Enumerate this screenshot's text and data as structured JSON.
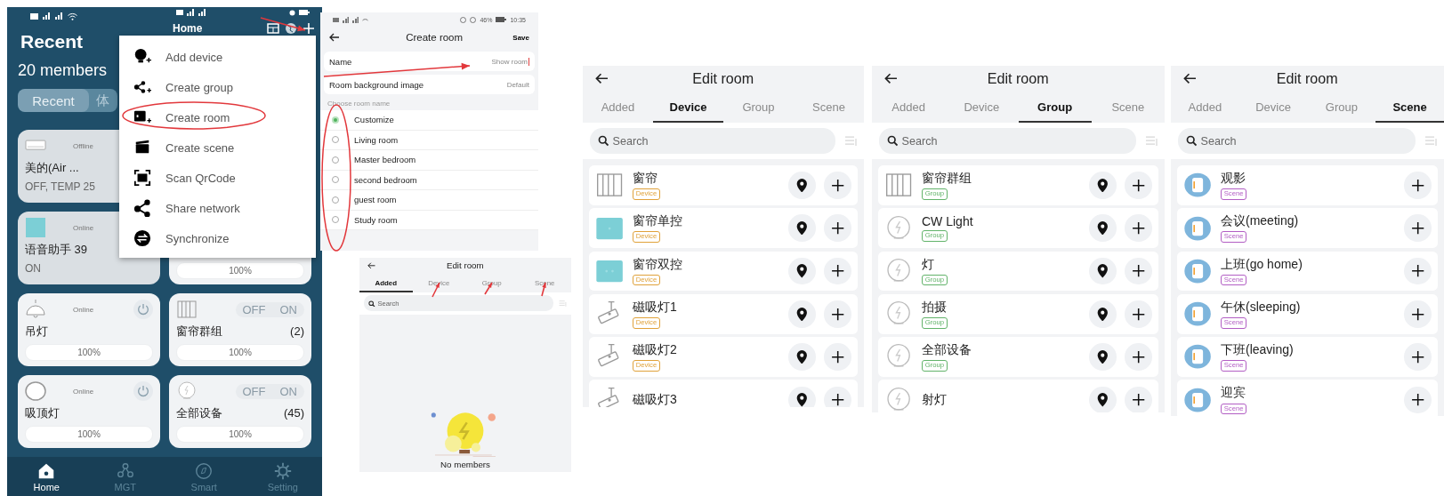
{
  "home_screen": {
    "title": "Recent",
    "members": "20 members",
    "tabs": [
      {
        "label": "Recent",
        "selected": true
      },
      {
        "label": "体",
        "selected": false
      }
    ],
    "cards": [
      {
        "kind": "summary",
        "icon": {
          "kind": "ac"
        },
        "status": "Offline",
        "name": "美的(Air ...",
        "detail": "OFF, TEMP 25"
      },
      {
        "kind": "summary",
        "icon": {
          "kind": "speaker"
        },
        "status": "Online",
        "name": "语音助手 39",
        "detail": "ON"
      },
      {
        "kind": "partial",
        "reading": "100%"
      },
      {
        "kind": "switch",
        "icon": {
          "kind": "pendant"
        },
        "status": "Online",
        "name": "吊灯",
        "reading": "100%"
      },
      {
        "kind": "group",
        "icon": {
          "kind": "curtain"
        },
        "off": "OFF",
        "on": "ON",
        "name": "窗帘群组",
        "count": "(2)",
        "reading": "100%"
      },
      {
        "kind": "switch",
        "icon": {
          "kind": "ceiling"
        },
        "status": "Online",
        "name": "吸顶灯",
        "reading": "100%"
      },
      {
        "kind": "group",
        "icon": {
          "kind": "bulb"
        },
        "off": "OFF",
        "on": "ON",
        "name": "全部设备",
        "count": "(45)",
        "reading": "100%"
      }
    ],
    "menu_header": "Home",
    "menu": [
      {
        "kind": "device",
        "label": "Add device"
      },
      {
        "kind": "group",
        "label": "Create group"
      },
      {
        "kind": "room",
        "label": "Create room"
      },
      {
        "kind": "scene",
        "label": "Create scene"
      },
      {
        "kind": "scan",
        "label": "Scan QrCode"
      },
      {
        "kind": "share",
        "label": "Share network"
      },
      {
        "kind": "sync",
        "label": "Synchronize"
      }
    ],
    "nav": [
      {
        "kind": "home",
        "label": "Home",
        "selected": true
      },
      {
        "kind": "mgt",
        "label": "MGT",
        "selected": false
      },
      {
        "kind": "smart",
        "label": "Smart",
        "selected": false
      },
      {
        "kind": "setting",
        "label": "Setting",
        "selected": false
      }
    ]
  },
  "create_room": {
    "battery": "46%",
    "time": "10:35",
    "title": "Create room",
    "save": "Save",
    "fields": [
      {
        "label": "Name",
        "value": "Show room"
      },
      {
        "label": "Room background image",
        "value": "Default"
      }
    ],
    "section": "Choose room name",
    "options": [
      {
        "label": "Customize",
        "selected": true
      },
      {
        "label": "Living room",
        "selected": false
      },
      {
        "label": "Master bedroom",
        "selected": false
      },
      {
        "label": "second bedroom",
        "selected": false
      },
      {
        "label": "guest room",
        "selected": false
      },
      {
        "label": "Study room",
        "selected": false
      }
    ]
  },
  "edit_rooms": [
    {
      "title": "Edit room",
      "tabs": [
        {
          "label": "Added",
          "selected": true
        },
        {
          "label": "Device",
          "selected": false
        },
        {
          "label": "Group",
          "selected": false
        },
        {
          "label": "Scene",
          "selected": false
        }
      ],
      "search": {
        "placeholder": "Search"
      },
      "empty_text": "No members"
    },
    {
      "title": "Edit room",
      "tabs": [
        {
          "label": "Added",
          "selected": false
        },
        {
          "label": "Device",
          "selected": true
        },
        {
          "label": "Group",
          "selected": false
        },
        {
          "label": "Scene",
          "selected": false
        }
      ],
      "search": {
        "placeholder": "Search"
      },
      "items": [
        {
          "kind": "device",
          "icon": {
            "kind": "curtain"
          },
          "name": "窗帘",
          "tag": "Device"
        },
        {
          "kind": "device",
          "icon": {
            "kind": "switch-single"
          },
          "name": "窗帘单控",
          "tag": "Device"
        },
        {
          "kind": "device",
          "icon": {
            "kind": "switch-double"
          },
          "name": "窗帘双控",
          "tag": "Device"
        },
        {
          "kind": "device",
          "icon": {
            "kind": "lamp"
          },
          "name": "磁吸灯1",
          "tag": "Device"
        },
        {
          "kind": "device",
          "icon": {
            "kind": "lamp"
          },
          "name": "磁吸灯2",
          "tag": "Device"
        },
        {
          "kind": "device",
          "icon": {
            "kind": "lamp"
          },
          "name": "磁吸灯3"
        }
      ]
    },
    {
      "title": "Edit room",
      "tabs": [
        {
          "label": "Added",
          "selected": false
        },
        {
          "label": "Device",
          "selected": false
        },
        {
          "label": "Group",
          "selected": true
        },
        {
          "label": "Scene",
          "selected": false
        }
      ],
      "search": {
        "placeholder": "Search"
      },
      "items": [
        {
          "kind": "group",
          "icon": {
            "kind": "curtain"
          },
          "name": "窗帘群组",
          "tag": "Group"
        },
        {
          "kind": "group",
          "icon": {
            "kind": "bulb"
          },
          "name": "CW Light",
          "tag": "Group"
        },
        {
          "kind": "group",
          "icon": {
            "kind": "bulb"
          },
          "name": "灯",
          "tag": "Group"
        },
        {
          "kind": "group",
          "icon": {
            "kind": "bulb"
          },
          "name": "拍摄",
          "tag": "Group"
        },
        {
          "kind": "group",
          "icon": {
            "kind": "bulb"
          },
          "name": "全部设备",
          "tag": "Group"
        },
        {
          "kind": "group",
          "icon": {
            "kind": "bulb"
          },
          "name": "射灯"
        }
      ]
    },
    {
      "title": "Edit room",
      "tabs": [
        {
          "label": "Added",
          "selected": false
        },
        {
          "label": "Device",
          "selected": false
        },
        {
          "label": "Group",
          "selected": false
        },
        {
          "label": "Scene",
          "selected": true
        }
      ],
      "search": {
        "placeholder": "Search"
      },
      "items": [
        {
          "kind": "scene",
          "icon": {
            "kind": "scene"
          },
          "name": "观影",
          "tag": "Scene"
        },
        {
          "kind": "scene",
          "icon": {
            "kind": "scene"
          },
          "name": "会议(meeting)",
          "tag": "Scene"
        },
        {
          "kind": "scene",
          "icon": {
            "kind": "scene"
          },
          "name": "上班(go home)",
          "tag": "Scene"
        },
        {
          "kind": "scene",
          "icon": {
            "kind": "scene"
          },
          "name": "午休(sleeping)",
          "tag": "Scene"
        },
        {
          "kind": "scene",
          "icon": {
            "kind": "scene"
          },
          "name": "下班(leaving)",
          "tag": "Scene"
        },
        {
          "kind": "scene",
          "icon": {
            "kind": "scene"
          },
          "name": "迎宾",
          "tag": "Scene"
        }
      ]
    }
  ]
}
